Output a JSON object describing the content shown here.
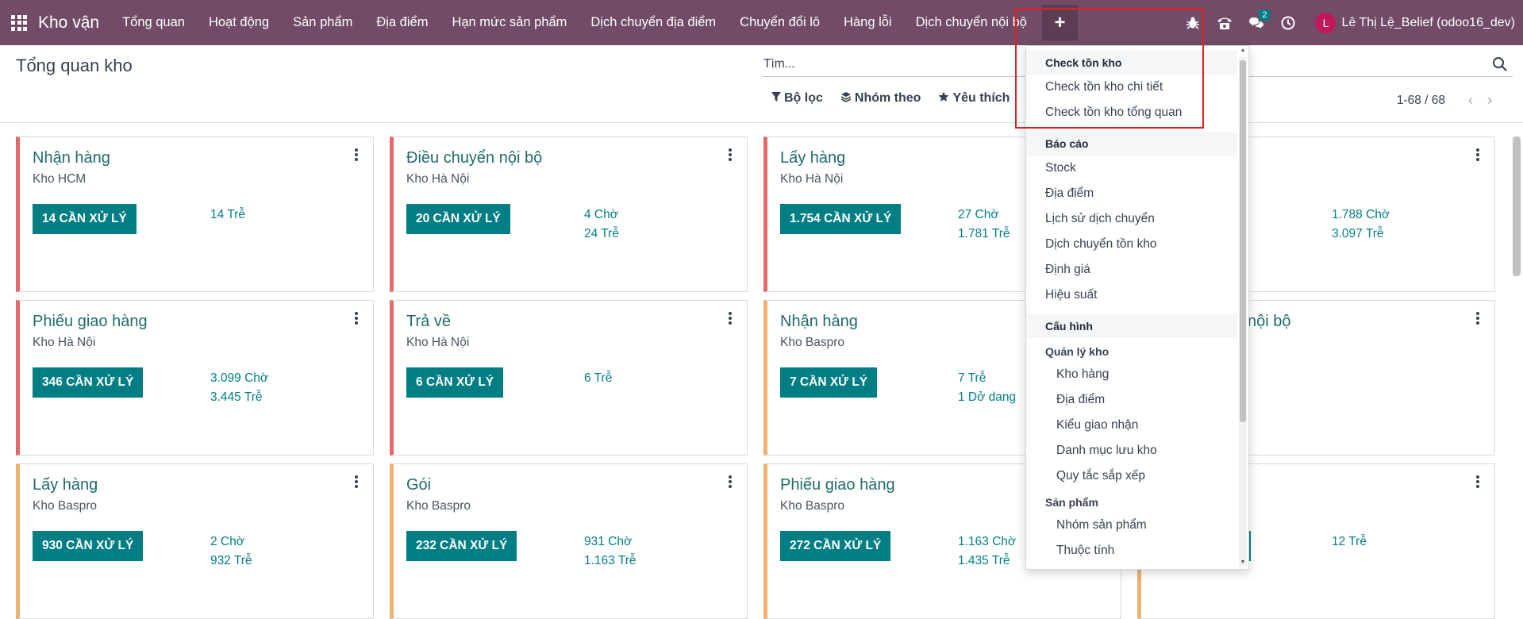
{
  "navbar": {
    "app_title": "Kho vận",
    "items": [
      "Tổng quan",
      "Hoạt động",
      "Sản phẩm",
      "Địa điểm",
      "Hạn mức sản phẩm",
      "Dịch chuyển địa điểm",
      "Chuyển đổi lô",
      "Hàng lỗi",
      "Dịch chuyển nội bộ"
    ],
    "plus": "+",
    "message_count": "2",
    "user_initial": "L",
    "user_name": "Lê Thị Lệ_Belief (odoo16_dev)",
    "accent": "#714b67"
  },
  "control": {
    "title": "Tổng quan kho",
    "search_placeholder": "Tìm...",
    "filter": "Bộ lọc",
    "group_by": "Nhóm theo",
    "favorites": "Yêu thích",
    "pager": "1-68 / 68"
  },
  "cards": [
    {
      "title": "Nhận hàng",
      "sub": "Kho HCM",
      "btn": "14 CẦN XỬ LÝ",
      "stats": [
        "14 Trễ"
      ],
      "color": "red"
    },
    {
      "title": "Điều chuyển nội bộ",
      "sub": "Kho Hà Nội",
      "btn": "20 CẦN XỬ LÝ",
      "stats": [
        "4 Chờ",
        "24 Trễ"
      ],
      "color": "red"
    },
    {
      "title": "Lấy hàng",
      "sub": "Kho Hà Nội",
      "btn": "1.754 CẦN XỬ LÝ",
      "stats": [
        "27 Chờ",
        "1.781 Trễ"
      ],
      "color": "red"
    },
    {
      "title": "",
      "sub": "",
      "btn": "LÝ",
      "stats": [
        "1.788 Chờ",
        "3.097 Trễ"
      ],
      "color": "red"
    },
    {
      "title": "Phiếu giao hàng",
      "sub": "Kho Hà Nội",
      "btn": "346 CẦN XỬ LÝ",
      "stats": [
        "3.099 Chờ",
        "3.445 Trễ"
      ],
      "color": "red"
    },
    {
      "title": "Trả về",
      "sub": "Kho Hà Nội",
      "btn": "6 CẦN XỬ LÝ",
      "stats": [
        "6 Trễ"
      ],
      "color": "red"
    },
    {
      "title": "Nhận hàng",
      "sub": "Kho Baspro",
      "btn": "7 CẦN XỬ LÝ",
      "stats": [
        "7 Trễ",
        "1 Dở dang"
      ],
      "color": "orange"
    },
    {
      "title": "nội bộ",
      "sub": "",
      "btn": "",
      "stats": [],
      "color": "orange"
    },
    {
      "title": "Lấy hàng",
      "sub": "Kho Baspro",
      "btn": "930 CẦN XỬ LÝ",
      "stats": [
        "2 Chờ",
        "932 Trễ"
      ],
      "color": "orange"
    },
    {
      "title": "Gói",
      "sub": "Kho Baspro",
      "btn": "232 CẦN XỬ LÝ",
      "stats": [
        "931 Chờ",
        "1.163 Trễ"
      ],
      "color": "orange"
    },
    {
      "title": "Phiếu giao hàng",
      "sub": "Kho Baspro",
      "btn": "272 CẦN XỬ LÝ",
      "stats": [
        "1.163 Chờ",
        "1.435 Trễ"
      ],
      "color": "orange"
    },
    {
      "title": "",
      "sub": "",
      "btn": "",
      "stats": [
        "12 Trễ"
      ],
      "color": "orange"
    }
  ],
  "dropdown": {
    "check_header": "Check tồn kho",
    "check_items": [
      "Check tồn kho chi tiết",
      "Check tồn kho tổng quan"
    ],
    "report_header": "Báo cáo",
    "report_items": [
      "Stock",
      "Địa điểm",
      "Lịch sử dịch chuyển",
      "Dịch chuyển tồn kho",
      "Định giá",
      "Hiệu suất"
    ],
    "config_header": "Cấu hình",
    "warehouse_sub": "Quản lý kho",
    "warehouse_items": [
      "Kho hàng",
      "Địa điểm",
      "Kiểu giao nhận",
      "Danh mục lưu kho",
      "Quy tắc sắp xếp"
    ],
    "product_sub": "Sản phẩm",
    "product_items": [
      "Nhóm sản phẩm",
      "Thuộc tính"
    ]
  },
  "colors": {
    "teal": "#017e84",
    "title_teal": "#1f6b6a",
    "red_border": "#e4696a",
    "orange_border": "#eeb170",
    "highlight": "#e0201e"
  }
}
